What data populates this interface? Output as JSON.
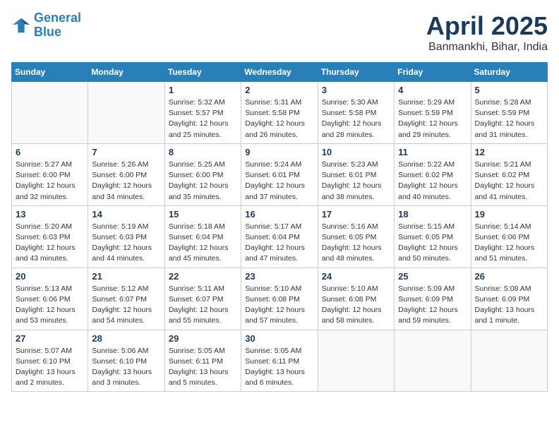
{
  "header": {
    "logo_line1": "General",
    "logo_line2": "Blue",
    "month_title": "April 2025",
    "location": "Banmankhi, Bihar, India"
  },
  "days_of_week": [
    "Sunday",
    "Monday",
    "Tuesday",
    "Wednesday",
    "Thursday",
    "Friday",
    "Saturday"
  ],
  "weeks": [
    [
      {
        "day": "",
        "info": ""
      },
      {
        "day": "",
        "info": ""
      },
      {
        "day": "1",
        "info": "Sunrise: 5:32 AM\nSunset: 5:57 PM\nDaylight: 12 hours and 25 minutes."
      },
      {
        "day": "2",
        "info": "Sunrise: 5:31 AM\nSunset: 5:58 PM\nDaylight: 12 hours and 26 minutes."
      },
      {
        "day": "3",
        "info": "Sunrise: 5:30 AM\nSunset: 5:58 PM\nDaylight: 12 hours and 28 minutes."
      },
      {
        "day": "4",
        "info": "Sunrise: 5:29 AM\nSunset: 5:59 PM\nDaylight: 12 hours and 29 minutes."
      },
      {
        "day": "5",
        "info": "Sunrise: 5:28 AM\nSunset: 5:59 PM\nDaylight: 12 hours and 31 minutes."
      }
    ],
    [
      {
        "day": "6",
        "info": "Sunrise: 5:27 AM\nSunset: 6:00 PM\nDaylight: 12 hours and 32 minutes."
      },
      {
        "day": "7",
        "info": "Sunrise: 5:26 AM\nSunset: 6:00 PM\nDaylight: 12 hours and 34 minutes."
      },
      {
        "day": "8",
        "info": "Sunrise: 5:25 AM\nSunset: 6:00 PM\nDaylight: 12 hours and 35 minutes."
      },
      {
        "day": "9",
        "info": "Sunrise: 5:24 AM\nSunset: 6:01 PM\nDaylight: 12 hours and 37 minutes."
      },
      {
        "day": "10",
        "info": "Sunrise: 5:23 AM\nSunset: 6:01 PM\nDaylight: 12 hours and 38 minutes."
      },
      {
        "day": "11",
        "info": "Sunrise: 5:22 AM\nSunset: 6:02 PM\nDaylight: 12 hours and 40 minutes."
      },
      {
        "day": "12",
        "info": "Sunrise: 5:21 AM\nSunset: 6:02 PM\nDaylight: 12 hours and 41 minutes."
      }
    ],
    [
      {
        "day": "13",
        "info": "Sunrise: 5:20 AM\nSunset: 6:03 PM\nDaylight: 12 hours and 43 minutes."
      },
      {
        "day": "14",
        "info": "Sunrise: 5:19 AM\nSunset: 6:03 PM\nDaylight: 12 hours and 44 minutes."
      },
      {
        "day": "15",
        "info": "Sunrise: 5:18 AM\nSunset: 6:04 PM\nDaylight: 12 hours and 45 minutes."
      },
      {
        "day": "16",
        "info": "Sunrise: 5:17 AM\nSunset: 6:04 PM\nDaylight: 12 hours and 47 minutes."
      },
      {
        "day": "17",
        "info": "Sunrise: 5:16 AM\nSunset: 6:05 PM\nDaylight: 12 hours and 48 minutes."
      },
      {
        "day": "18",
        "info": "Sunrise: 5:15 AM\nSunset: 6:05 PM\nDaylight: 12 hours and 50 minutes."
      },
      {
        "day": "19",
        "info": "Sunrise: 5:14 AM\nSunset: 6:06 PM\nDaylight: 12 hours and 51 minutes."
      }
    ],
    [
      {
        "day": "20",
        "info": "Sunrise: 5:13 AM\nSunset: 6:06 PM\nDaylight: 12 hours and 53 minutes."
      },
      {
        "day": "21",
        "info": "Sunrise: 5:12 AM\nSunset: 6:07 PM\nDaylight: 12 hours and 54 minutes."
      },
      {
        "day": "22",
        "info": "Sunrise: 5:11 AM\nSunset: 6:07 PM\nDaylight: 12 hours and 55 minutes."
      },
      {
        "day": "23",
        "info": "Sunrise: 5:10 AM\nSunset: 6:08 PM\nDaylight: 12 hours and 57 minutes."
      },
      {
        "day": "24",
        "info": "Sunrise: 5:10 AM\nSunset: 6:08 PM\nDaylight: 12 hours and 58 minutes."
      },
      {
        "day": "25",
        "info": "Sunrise: 5:09 AM\nSunset: 6:09 PM\nDaylight: 12 hours and 59 minutes."
      },
      {
        "day": "26",
        "info": "Sunrise: 5:08 AM\nSunset: 6:09 PM\nDaylight: 13 hours and 1 minute."
      }
    ],
    [
      {
        "day": "27",
        "info": "Sunrise: 5:07 AM\nSunset: 6:10 PM\nDaylight: 13 hours and 2 minutes."
      },
      {
        "day": "28",
        "info": "Sunrise: 5:06 AM\nSunset: 6:10 PM\nDaylight: 13 hours and 3 minutes."
      },
      {
        "day": "29",
        "info": "Sunrise: 5:05 AM\nSunset: 6:11 PM\nDaylight: 13 hours and 5 minutes."
      },
      {
        "day": "30",
        "info": "Sunrise: 5:05 AM\nSunset: 6:11 PM\nDaylight: 13 hours and 6 minutes."
      },
      {
        "day": "",
        "info": ""
      },
      {
        "day": "",
        "info": ""
      },
      {
        "day": "",
        "info": ""
      }
    ]
  ]
}
